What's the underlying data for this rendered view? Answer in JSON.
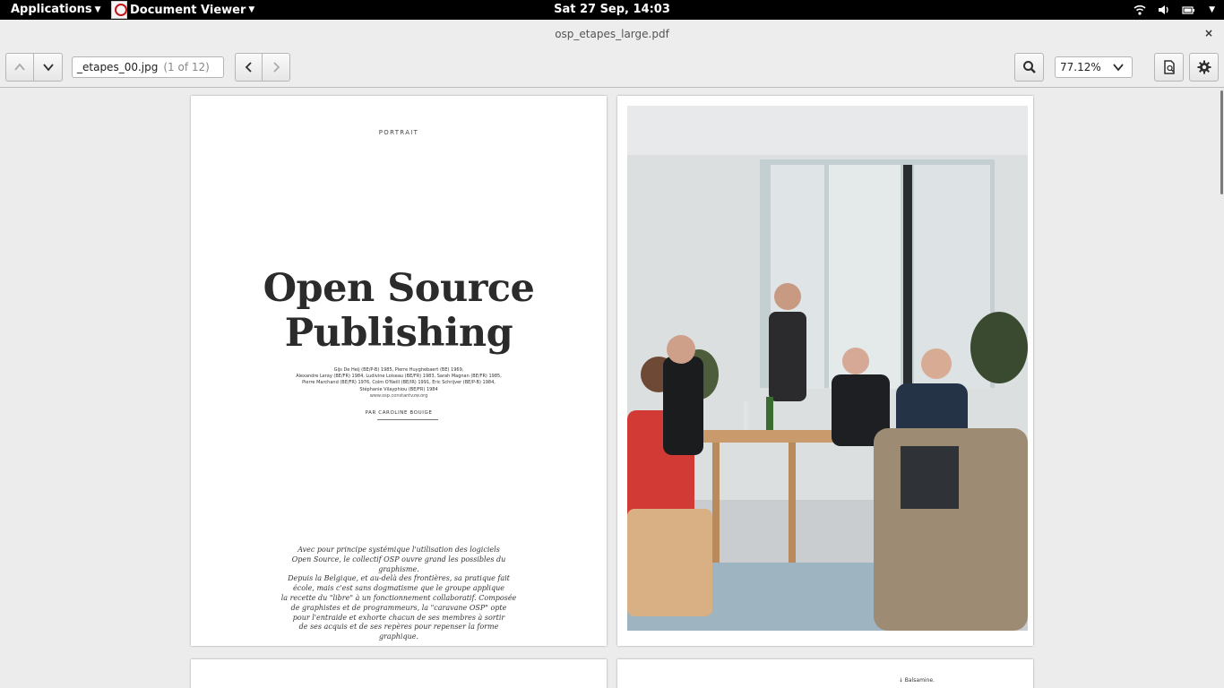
{
  "topbar": {
    "applications": "Applications",
    "app_name": "Document Viewer",
    "clock": "Sat 27 Sep, 14:03",
    "tray_icons": [
      "wifi-icon",
      "volume-icon",
      "battery-icon"
    ]
  },
  "window": {
    "title": "osp_etapes_large.pdf",
    "close_glyph": "×"
  },
  "toolbar": {
    "page_label": "_etapes_00.jpg",
    "page_count": "(1 of 12)",
    "zoom": "77.12%"
  },
  "document": {
    "page1": {
      "section": "PORTRAIT",
      "title_line1": "Open Source",
      "title_line2": "Publishing",
      "credits": [
        "Gijs De Heij (BE/P-B) 1985, Pierre Huyghebaert (BE) 1969,",
        "Alexandre Leray (BE/FR) 1984, Ludivine Loiseau (BE/FR) 1983, Sarah Magnan (BE/FR) 1985,",
        "Pierre Marchand (BE/FR) 1976, Colm O'Neill (BE/IR) 1991, Eric Schrijver (BE/P-B) 1984,",
        "Stéphanie Vilayphiou (BE/FR) 1984"
      ],
      "url": "www.osp.constantvzw.org",
      "byline": "PAR CAROLINE BOUIGE",
      "intro": [
        "Avec pour principe systémique l'utilisation des logiciels",
        "Open Source, le collectif OSP ouvre grand les possibles du graphisme.",
        "Depuis la Belgique, et au-delà des frontières, sa pratique fait",
        "école, mais c'est sans dogmatisme que le groupe applique",
        "la recette du \"libre\" à un fonctionnement collaboratif. Composée",
        "de graphistes et de programmeurs, la \"caravane OSP\" opte",
        "pour l'entraide et exhorte chacun de ses membres à sortir",
        "de ses acquis et de ses repères pour repenser la forme graphique."
      ]
    },
    "page4": {
      "label": "↓ Balsamine."
    }
  },
  "colors": {
    "topbar_bg": "#000000",
    "window_bg": "#ededed",
    "doc_bg": "#ececec"
  }
}
